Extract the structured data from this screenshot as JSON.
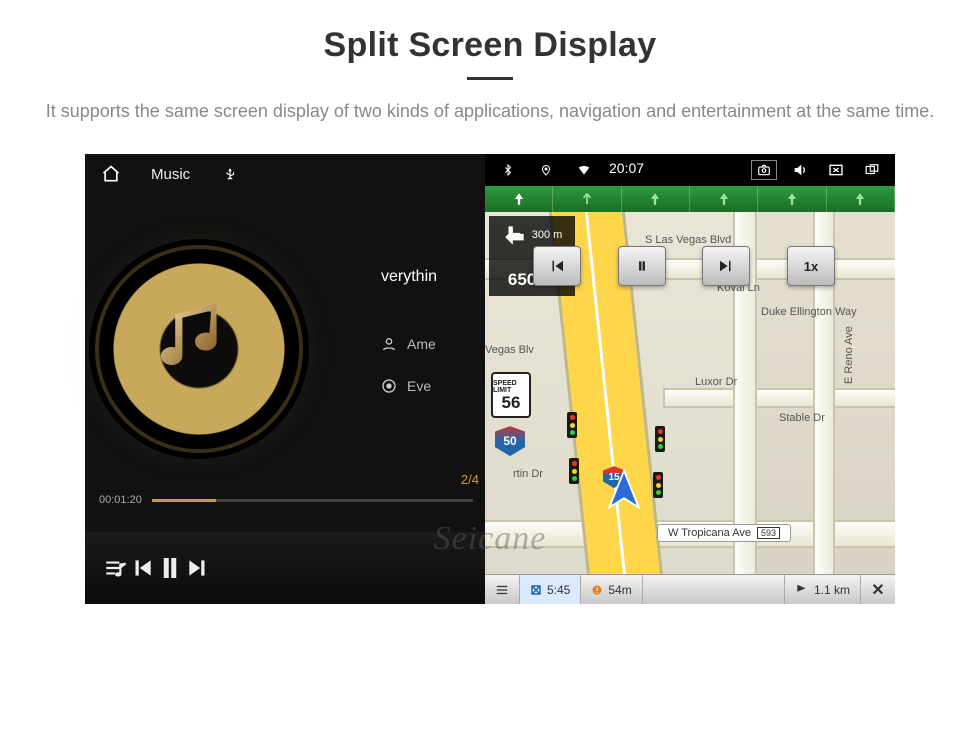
{
  "header": {
    "title": "Split Screen Display",
    "description": "It supports the same screen display of two kinds of applications, navigation and entertainment at the same time."
  },
  "music": {
    "topbar": {
      "title": "Music"
    },
    "track_title_visible": "verythin",
    "artist_visible": "Ame",
    "album_visible": "Eve",
    "counter": "2/4",
    "time_elapsed": "00:01:20",
    "icons": {
      "home": "home-icon",
      "usb": "usb-icon",
      "user": "user-icon",
      "disc": "disc-icon",
      "queue": "queue-icon",
      "prev": "prev-icon",
      "pause": "pause-icon",
      "next": "next-icon"
    }
  },
  "statusbar": {
    "time": "20:07",
    "icons": {
      "bluetooth": "bluetooth-icon",
      "gps": "gps-pin-icon",
      "wifi": "wifi-icon",
      "camera": "camera-icon",
      "volume": "volume-icon",
      "close_app": "close-app-icon",
      "split": "split-icon"
    }
  },
  "nav": {
    "turn": {
      "next_distance": "300 m",
      "approach_distance": "650 m"
    },
    "media_btns": {
      "prev": "◄◄",
      "pause": "❚❚",
      "next": "►►",
      "speed": "1x"
    },
    "speed_limit_label": "SPEED LIMIT",
    "speed_limit_value": "56",
    "route_shield": "50",
    "interstate": "15",
    "streets": {
      "s_las_vegas": "S Las Vegas Blvd",
      "koval": "Koval Ln",
      "duke": "Duke Ellington Way",
      "reno": "E Reno Ave",
      "luxor": "Luxor Dr",
      "stable": "Stable Dr",
      "martin": "rtin Dr",
      "tropicana": "W Tropicana Ave",
      "tropicana_exit": "593",
      "vegas_blv": "Vegas Blv"
    },
    "bottom": {
      "eta": "5:45",
      "alert_dist": "54m",
      "dest_dist": "1.1 km",
      "close": "✕"
    },
    "lane_arrows": 6
  },
  "watermark": "Seicane",
  "colors": {
    "accent_gold": "#c79b45",
    "nav_green": "#2c9a3c",
    "highway_yellow": "#ffd54a"
  }
}
